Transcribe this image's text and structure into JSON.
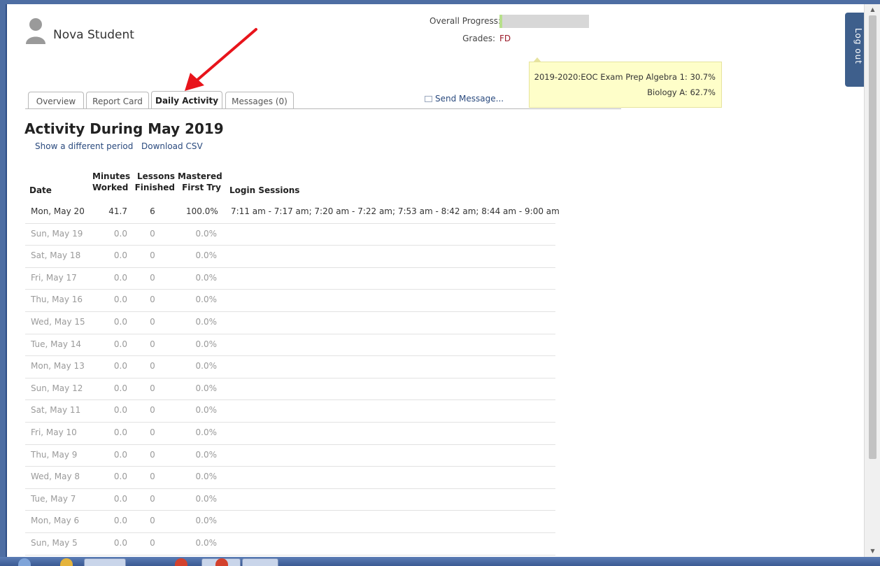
{
  "header": {
    "student_name": "Nova Student",
    "overall_progress_label": "Overall Progress:",
    "overall_progress_fraction": 0.03,
    "grades_label": "Grades:",
    "grades_value": "FD",
    "logout_label": "Log out"
  },
  "tooltip": {
    "rows": [
      {
        "course": "2019-2020:EOC Exam Prep Algebra 1:",
        "value": "30.7%"
      },
      {
        "course": "Biology A:",
        "value": "62.7%"
      }
    ]
  },
  "tabs": [
    {
      "label": "Overview",
      "active": false
    },
    {
      "label": "Report Card",
      "active": false
    },
    {
      "label": "Daily Activity",
      "active": true
    },
    {
      "label": "Messages (0)",
      "active": false
    }
  ],
  "send_message_label": "Send Message...",
  "activity": {
    "title": "Activity During May 2019",
    "links": [
      "Show a different period",
      "Download CSV"
    ],
    "columns": {
      "date": "Date",
      "minutes": [
        "Minutes",
        "Worked"
      ],
      "lessons": [
        "Lessons",
        "Finished"
      ],
      "mastered": [
        "Mastered",
        "First Try"
      ],
      "login": "Login Sessions"
    },
    "rows": [
      {
        "date": "Mon, May 20",
        "minutes": "41.7",
        "lessons": "6",
        "mastered": "100.0%",
        "login": "7:11 am - 7:17 am; 7:20 am - 7:22 am; 7:53 am - 8:42 am; 8:44 am - 9:00 am",
        "active": true
      },
      {
        "date": "Sun, May 19",
        "minutes": "0.0",
        "lessons": "0",
        "mastered": "0.0%",
        "login": "",
        "active": false
      },
      {
        "date": "Sat, May 18",
        "minutes": "0.0",
        "lessons": "0",
        "mastered": "0.0%",
        "login": "",
        "active": false
      },
      {
        "date": "Fri, May 17",
        "minutes": "0.0",
        "lessons": "0",
        "mastered": "0.0%",
        "login": "",
        "active": false
      },
      {
        "date": "Thu, May 16",
        "minutes": "0.0",
        "lessons": "0",
        "mastered": "0.0%",
        "login": "",
        "active": false
      },
      {
        "date": "Wed, May 15",
        "minutes": "0.0",
        "lessons": "0",
        "mastered": "0.0%",
        "login": "",
        "active": false
      },
      {
        "date": "Tue, May 14",
        "minutes": "0.0",
        "lessons": "0",
        "mastered": "0.0%",
        "login": "",
        "active": false
      },
      {
        "date": "Mon, May 13",
        "minutes": "0.0",
        "lessons": "0",
        "mastered": "0.0%",
        "login": "",
        "active": false
      },
      {
        "date": "Sun, May 12",
        "minutes": "0.0",
        "lessons": "0",
        "mastered": "0.0%",
        "login": "",
        "active": false
      },
      {
        "date": "Sat, May 11",
        "minutes": "0.0",
        "lessons": "0",
        "mastered": "0.0%",
        "login": "",
        "active": false
      },
      {
        "date": "Fri, May 10",
        "minutes": "0.0",
        "lessons": "0",
        "mastered": "0.0%",
        "login": "",
        "active": false
      },
      {
        "date": "Thu, May 9",
        "minutes": "0.0",
        "lessons": "0",
        "mastered": "0.0%",
        "login": "",
        "active": false
      },
      {
        "date": "Wed, May 8",
        "minutes": "0.0",
        "lessons": "0",
        "mastered": "0.0%",
        "login": "",
        "active": false
      },
      {
        "date": "Tue, May 7",
        "minutes": "0.0",
        "lessons": "0",
        "mastered": "0.0%",
        "login": "",
        "active": false
      },
      {
        "date": "Mon, May 6",
        "minutes": "0.0",
        "lessons": "0",
        "mastered": "0.0%",
        "login": "",
        "active": false
      },
      {
        "date": "Sun, May 5",
        "minutes": "0.0",
        "lessons": "0",
        "mastered": "0.0%",
        "login": "",
        "active": false
      }
    ]
  },
  "colors": {
    "accent": "#2a4a7e",
    "grade": "#9b1b2a",
    "logout_bg": "#3e5f8c",
    "tooltip_bg": "#fefec9",
    "arrow": "#e8141b"
  },
  "icons": {
    "avatar": "user-silhouette-icon",
    "send_message": "envelope-icon",
    "annotation": "red-arrow-icon"
  }
}
